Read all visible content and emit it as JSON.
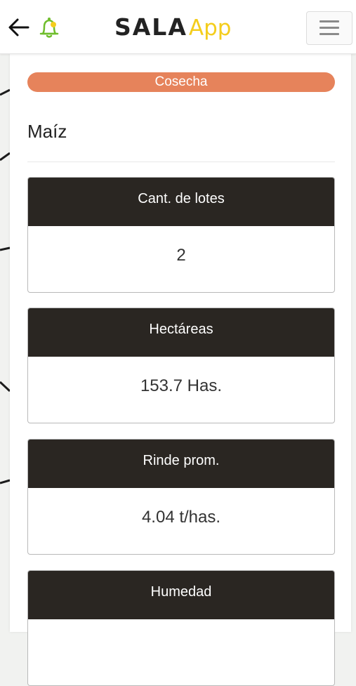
{
  "header": {
    "back_icon": "arrow-left-icon",
    "bell_icon": "bell-icon",
    "logo_primary": "SALA",
    "logo_secondary": "App",
    "menu_icon": "hamburger-menu-icon",
    "colors": {
      "logo_primary": "#222222",
      "logo_secondary": "#f4cd1c",
      "bell_stroke": "#6fbd2c",
      "bell_dot": "#f4cd1c"
    }
  },
  "main": {
    "status_badge": "Cosecha",
    "crop_title": "Maíz",
    "cards": [
      {
        "label": "Cant. de lotes",
        "value": "2"
      },
      {
        "label": "Hectáreas",
        "value": "153.7 Has."
      },
      {
        "label": "Rinde prom.",
        "value": "4.04 t/has."
      },
      {
        "label": "Humedad",
        "value": ""
      }
    ],
    "colors": {
      "badge": "#e6835b",
      "card_header": "#2a2622"
    }
  }
}
